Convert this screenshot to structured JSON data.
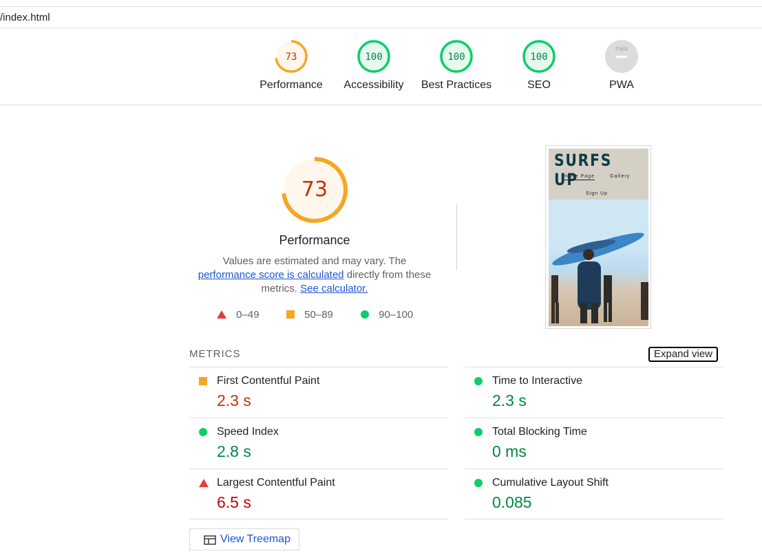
{
  "url": "/index.html",
  "gauges": [
    {
      "label": "Performance",
      "score": "73",
      "value": 0.73,
      "color": "#f5a623",
      "fill": "#fff6ec",
      "text_color": "#c33300"
    },
    {
      "label": "Accessibility",
      "score": "100",
      "value": 1.0,
      "color": "#0cce6b",
      "fill": "#e5f9ee",
      "text_color": "#018642"
    },
    {
      "label": "Best Practices",
      "score": "100",
      "value": 1.0,
      "color": "#0cce6b",
      "fill": "#e5f9ee",
      "text_color": "#018642"
    },
    {
      "label": "SEO",
      "score": "100",
      "value": 1.0,
      "color": "#0cce6b",
      "fill": "#e5f9ee",
      "text_color": "#018642"
    },
    {
      "label": "PWA",
      "badge": "PWA",
      "color": "#dcdcdc"
    }
  ],
  "performance": {
    "score": "73",
    "value": 0.73,
    "title": "Performance",
    "desc_1": "Values are estimated and may vary. The",
    "link_1": "performance score is calculated",
    "desc_2": "directly from these metrics.",
    "link_2": "See calculator."
  },
  "legend": {
    "fail": "0–49",
    "average": "50–89",
    "pass": "90–100"
  },
  "screenshot": {
    "title": "SURFS UP",
    "nav_home": "Home Page",
    "nav_gallery": "Gallery",
    "nav_signup": "Sign Up"
  },
  "metrics": {
    "heading": "METRICS",
    "expand": "Expand view",
    "items": [
      {
        "name": "First Contentful Paint",
        "value": "2.3 s",
        "rating": "average"
      },
      {
        "name": "Time to Interactive",
        "value": "2.3 s",
        "rating": "pass"
      },
      {
        "name": "Speed Index",
        "value": "2.8 s",
        "rating": "pass"
      },
      {
        "name": "Total Blocking Time",
        "value": "0 ms",
        "rating": "pass"
      },
      {
        "name": "Largest Contentful Paint",
        "value": "6.5 s",
        "rating": "fail"
      },
      {
        "name": "Cumulative Layout Shift",
        "value": "0.085",
        "rating": "pass"
      }
    ]
  },
  "treemap_label": "View Treemap",
  "colors": {
    "fail": "#eb3b3b",
    "average": "#f5a623",
    "pass": "#0cce6b",
    "link": "#1a55d6"
  }
}
